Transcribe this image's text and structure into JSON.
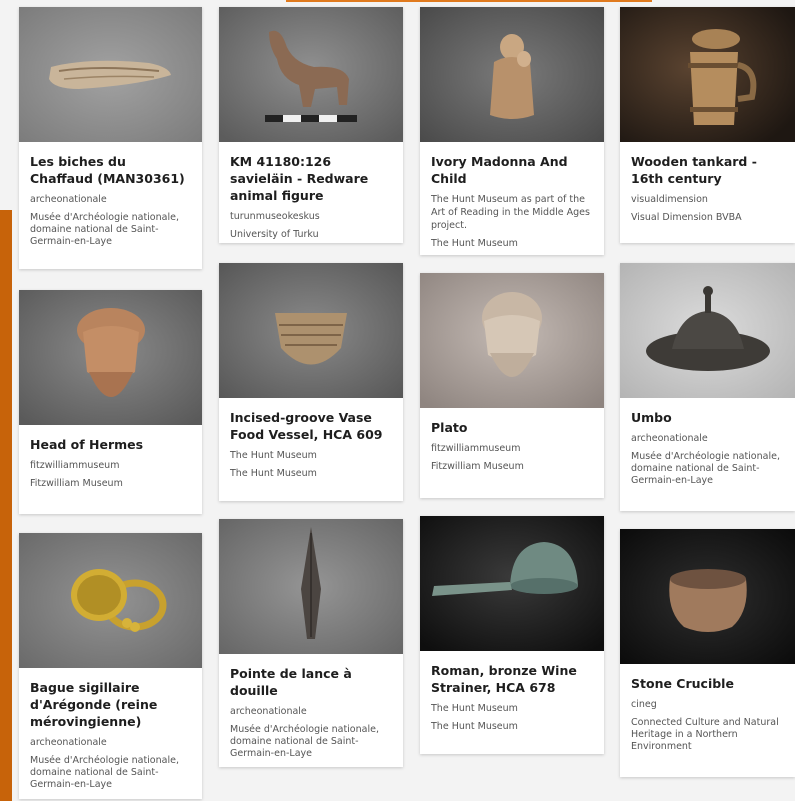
{
  "cards": [
    {
      "title": "Les biches du Chaffaud (MAN30361)",
      "author": "archeonationale",
      "org": "Musée d'Archéologie nationale, domaine national de Saint-Germain-en-Laye",
      "thumb_bg": "#8a8a8a",
      "thumb_icon": "carved-bone-thumbnail"
    },
    {
      "title": "KM 41180:126 savieläin - Redware animal figure",
      "author": "turunmuseokeskus",
      "org": "University of Turku",
      "thumb_bg": "#6e6e6e",
      "thumb_icon": "animal-figure-thumbnail"
    },
    {
      "title": "Ivory Madonna And Child",
      "author": "The Hunt Museum as part of the Art of Reading in the Middle Ages project.",
      "org": "The Hunt Museum",
      "thumb_bg": "#5f5f5f",
      "thumb_icon": "madonna-thumbnail"
    },
    {
      "title": "Wooden tankard - 16th century",
      "author": "visualdimension",
      "org": "Visual Dimension BVBA",
      "thumb_bg": "#2b2118",
      "thumb_icon": "tankard-thumbnail"
    },
    {
      "title": "Head of Hermes",
      "author": "fitzwilliammuseum",
      "org": "Fitzwilliam Museum",
      "thumb_bg": "#6a6a6a",
      "thumb_icon": "hermes-head-thumbnail"
    },
    {
      "title": "Incised-groove Vase Food Vessel, HCA 609",
      "author": "The Hunt Museum",
      "org": "The Hunt Museum",
      "thumb_bg": "#6a6a6a",
      "thumb_icon": "vase-thumbnail"
    },
    {
      "title": "Plato",
      "author": "fitzwilliammuseum",
      "org": "Fitzwilliam Museum",
      "thumb_bg": "#a89e98",
      "thumb_icon": "plato-head-thumbnail"
    },
    {
      "title": "Umbo",
      "author": "archeonationale",
      "org": "Musée d'Archéologie nationale, domaine national de Saint-Germain-en-Laye",
      "thumb_bg": "#cfcfcf",
      "thumb_icon": "umbo-thumbnail"
    },
    {
      "title": "Bague sigillaire d'Arégonde (reine mérovingienne)",
      "author": "archeonationale",
      "org": "Musée d'Archéologie nationale, domaine national de Saint-Germain-en-Laye",
      "thumb_bg": "#7d7d7d",
      "thumb_icon": "ring-thumbnail"
    },
    {
      "title": "Pointe de lance à douille",
      "author": "archeonationale",
      "org": "Musée d'Archéologie nationale, domaine national de Saint-Germain-en-Laye",
      "thumb_bg": "#7a7a7a",
      "thumb_icon": "spearhead-thumbnail"
    },
    {
      "title": "Roman, bronze Wine Strainer, HCA 678",
      "author": "The Hunt Museum",
      "org": "The Hunt Museum",
      "thumb_bg": "#1a1a1a",
      "thumb_icon": "strainer-thumbnail"
    },
    {
      "title": "Stone Crucible",
      "author": "cineg",
      "org": "Connected Culture and Natural Heritage in a Northern Environment",
      "thumb_bg": "#151515",
      "thumb_icon": "crucible-thumbnail"
    }
  ],
  "colors": {
    "accent": "#c7630a",
    "card_bg": "#ffffff",
    "page_bg": "#f3f3f3"
  }
}
